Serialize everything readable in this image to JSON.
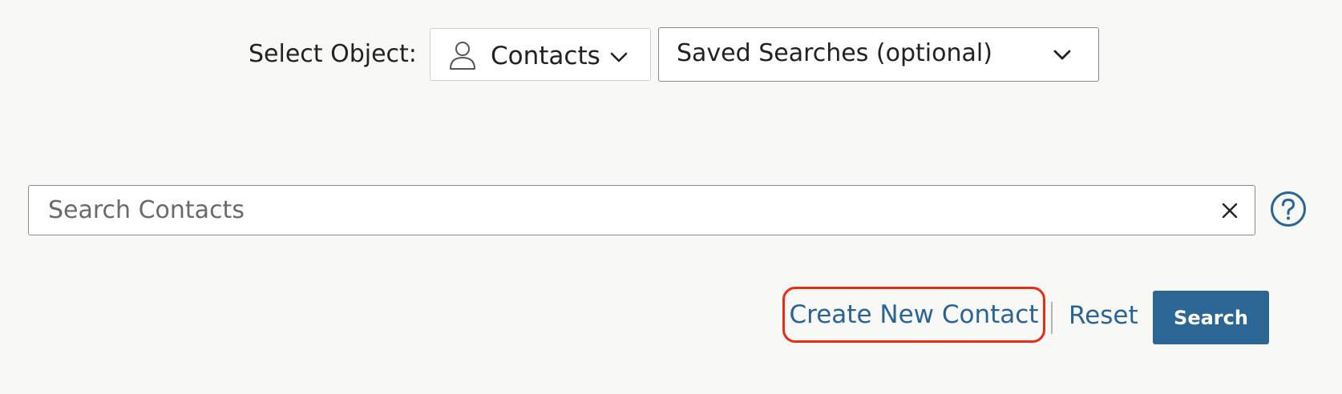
{
  "object_selector": {
    "label": "Select Object:",
    "selected": "Contacts",
    "icon": "person-icon"
  },
  "saved_searches": {
    "selected": "Saved Searches (optional)",
    "icon": "chevron-down-icon"
  },
  "search": {
    "placeholder": "Search Contacts",
    "value": "",
    "clear_icon": "close-icon",
    "help_icon": "help-circle-icon"
  },
  "actions": {
    "create_label": "Create New Contact",
    "reset_label": "Reset",
    "search_label": "Search"
  },
  "colors": {
    "link": "#2a6496",
    "primary_button": "#2c6694",
    "highlight_ring": "#ec2b14",
    "background": "#f8f8f6"
  }
}
